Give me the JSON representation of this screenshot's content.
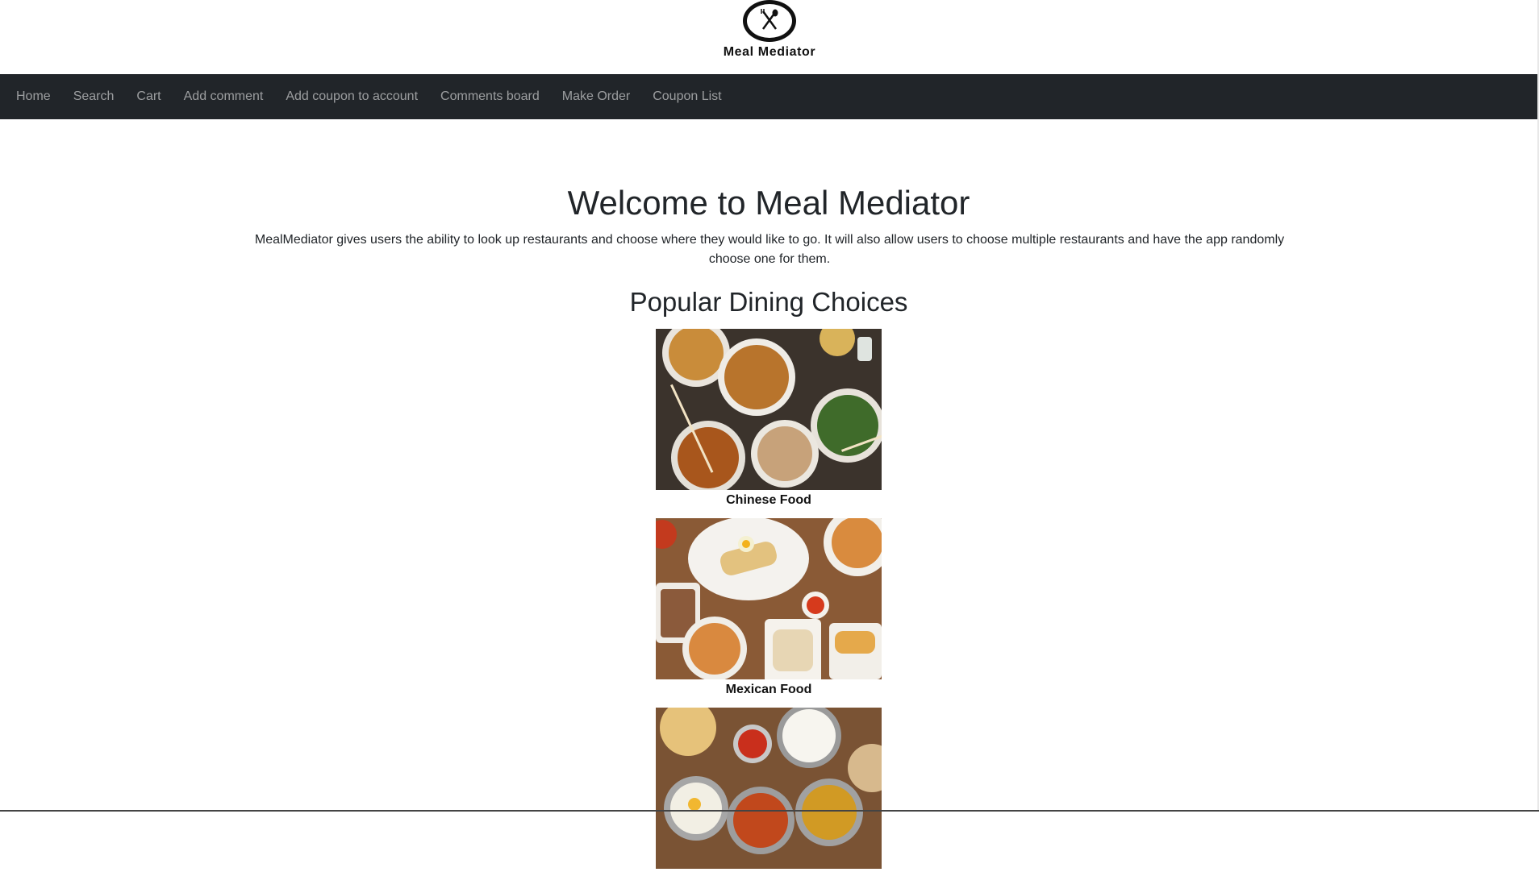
{
  "brand": {
    "name": "Meal Mediator"
  },
  "nav": {
    "items": [
      "Home",
      "Search",
      "Cart",
      "Add comment",
      "Add coupon to account",
      "Comments board",
      "Make Order",
      "Coupon List"
    ]
  },
  "main": {
    "title": "Welcome to Meal Mediator",
    "intro": "MealMediator gives users the ability to look up restaurants and choose where they would like to go. It will also allow users to choose multiple restaurants and have the app randomly choose one for them.",
    "section_title": "Popular Dining Choices",
    "cards": [
      {
        "caption": "Chinese Food"
      },
      {
        "caption": "Mexican Food"
      },
      {
        "caption": ""
      }
    ]
  },
  "colors": {
    "navbar_bg": "#212529",
    "nav_text": "#9a9da0",
    "text": "#212529"
  }
}
